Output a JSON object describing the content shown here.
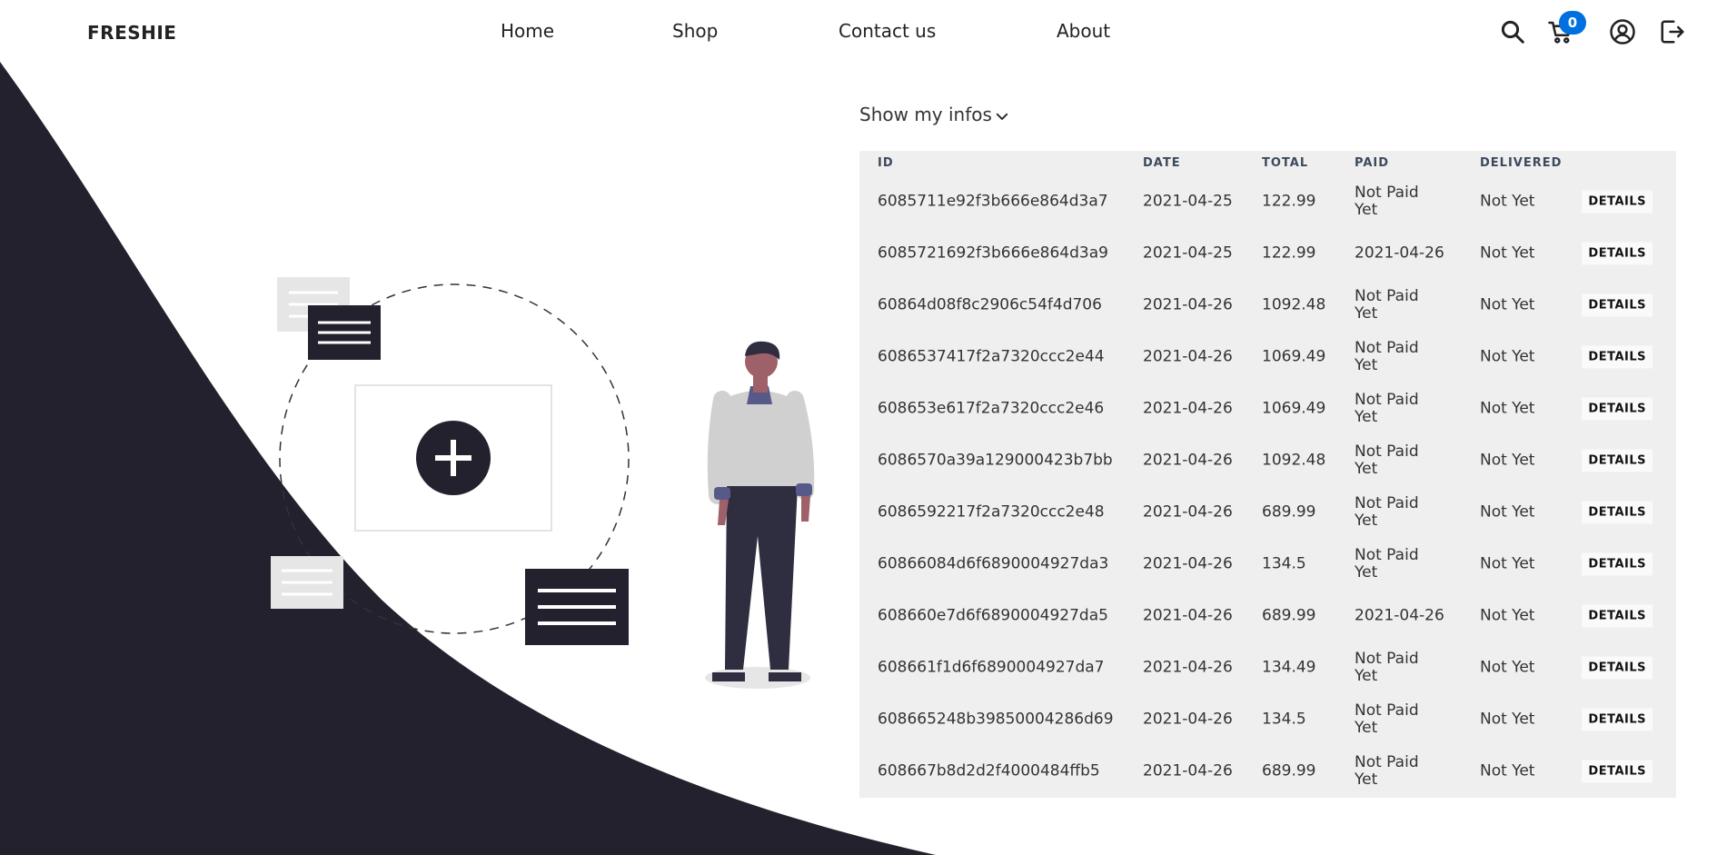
{
  "header": {
    "brand": "FRESHIE",
    "nav": [
      "Home",
      "Shop",
      "Contact us",
      "About"
    ],
    "cart_count": "0",
    "icons": [
      "search-icon",
      "cart-icon",
      "account-icon",
      "logout-icon"
    ]
  },
  "colors": {
    "dark": "#22212d",
    "accent": "#0070e0",
    "table_bg": "#efefef"
  },
  "main": {
    "show_infos_label": "Show my infos",
    "columns": [
      "ID",
      "DATE",
      "TOTAL",
      "PAID",
      "DELIVERED"
    ],
    "details_label": "DETAILS",
    "orders": [
      {
        "id": "6085711e92f3b666e864d3a7",
        "date": "2021-04-25",
        "total": "122.99",
        "paid": "Not Paid Yet",
        "delivered": "Not Yet"
      },
      {
        "id": "6085721692f3b666e864d3a9",
        "date": "2021-04-25",
        "total": "122.99",
        "paid": "2021-04-26",
        "delivered": "Not Yet"
      },
      {
        "id": "60864d08f8c2906c54f4d706",
        "date": "2021-04-26",
        "total": "1092.48",
        "paid": "Not Paid Yet",
        "delivered": "Not Yet"
      },
      {
        "id": "6086537417f2a7320ccc2e44",
        "date": "2021-04-26",
        "total": "1069.49",
        "paid": "Not Paid Yet",
        "delivered": "Not Yet"
      },
      {
        "id": "608653e617f2a7320ccc2e46",
        "date": "2021-04-26",
        "total": "1069.49",
        "paid": "Not Paid Yet",
        "delivered": "Not Yet"
      },
      {
        "id": "6086570a39a129000423b7bb",
        "date": "2021-04-26",
        "total": "1092.48",
        "paid": "Not Paid Yet",
        "delivered": "Not Yet"
      },
      {
        "id": "6086592217f2a7320ccc2e48",
        "date": "2021-04-26",
        "total": "689.99",
        "paid": "Not Paid Yet",
        "delivered": "Not Yet"
      },
      {
        "id": "60866084d6f6890004927da3",
        "date": "2021-04-26",
        "total": "134.5",
        "paid": "Not Paid Yet",
        "delivered": "Not Yet"
      },
      {
        "id": "608660e7d6f6890004927da5",
        "date": "2021-04-26",
        "total": "689.99",
        "paid": "2021-04-26",
        "delivered": "Not Yet"
      },
      {
        "id": "608661f1d6f6890004927da7",
        "date": "2021-04-26",
        "total": "134.49",
        "paid": "Not Paid Yet",
        "delivered": "Not Yet"
      },
      {
        "id": "608665248b39850004286d69",
        "date": "2021-04-26",
        "total": "134.5",
        "paid": "Not Paid Yet",
        "delivered": "Not Yet"
      },
      {
        "id": "608667b8d2d2f4000484ffb5",
        "date": "2021-04-26",
        "total": "689.99",
        "paid": "Not Paid Yet",
        "delivered": "Not Yet"
      }
    ]
  }
}
